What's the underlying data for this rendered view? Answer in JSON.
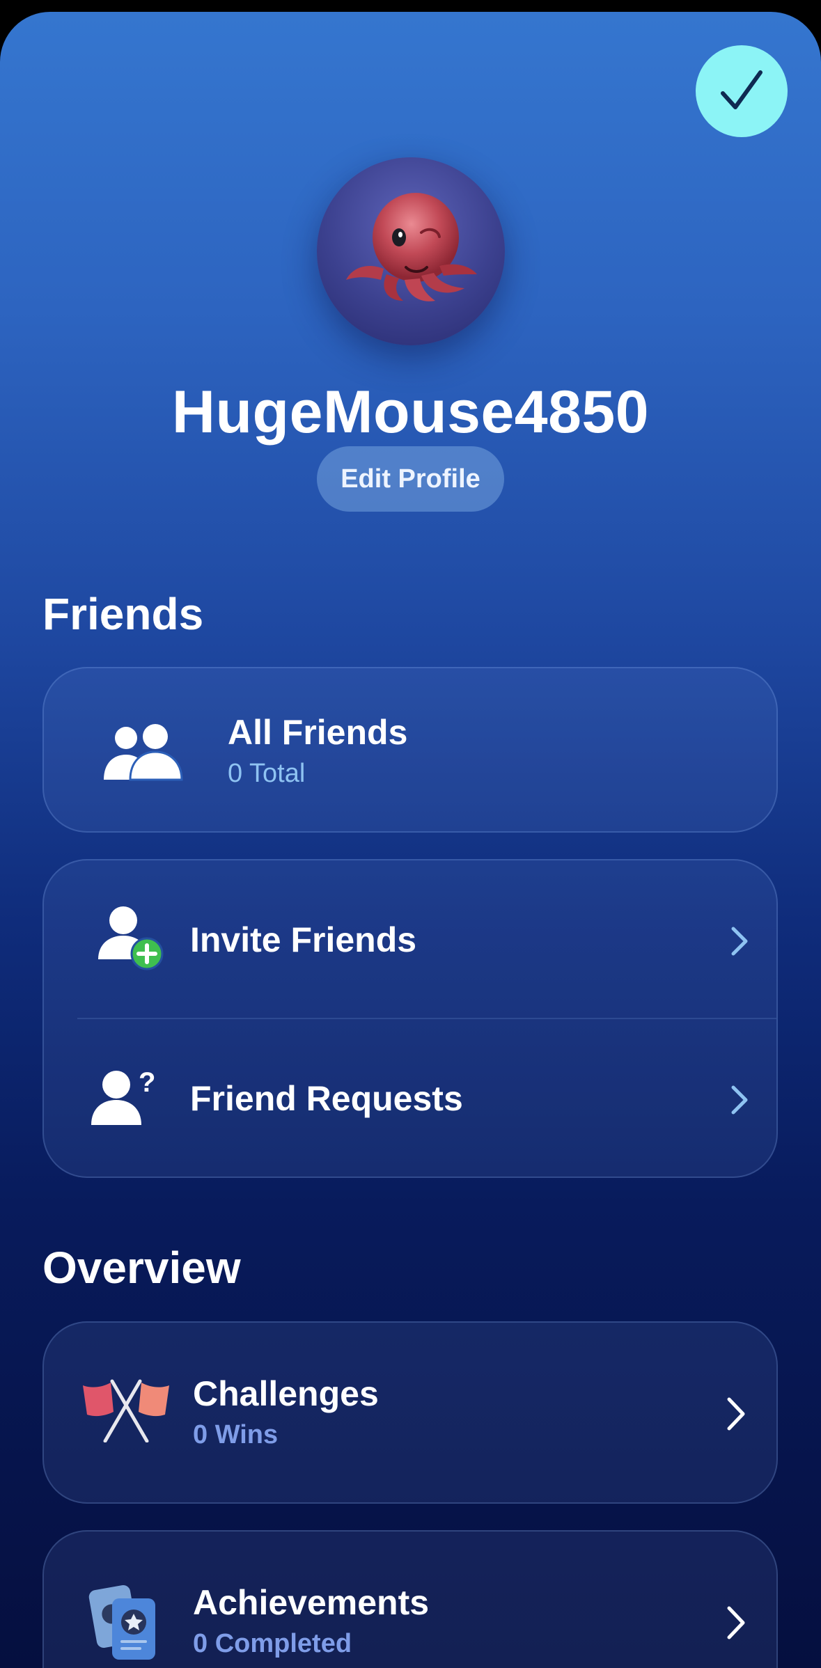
{
  "profile": {
    "username": "HugeMouse4850",
    "edit_label": "Edit Profile"
  },
  "header": {
    "done_icon": "checkmark-icon"
  },
  "friends": {
    "title": "Friends",
    "all_friends": {
      "label": "All Friends",
      "sub": "0 Total",
      "icon": "two-people-icon"
    },
    "invite": {
      "label": "Invite Friends",
      "icon": "person-plus-icon"
    },
    "requests": {
      "label": "Friend Requests",
      "icon": "person-question-icon"
    }
  },
  "overview": {
    "title": "Overview",
    "challenges": {
      "label": "Challenges",
      "sub": "0 Wins",
      "icon": "crossed-flags-icon"
    },
    "achievements": {
      "label": "Achievements",
      "sub": "0 Completed",
      "icon": "badge-cards-icon"
    }
  },
  "colors": {
    "accent_cyan": "#8cf4f6",
    "sub_light_blue": "#8fc3f2",
    "sub_muted_blue": "#7f9de8",
    "plus_green": "#3fbf4f"
  }
}
